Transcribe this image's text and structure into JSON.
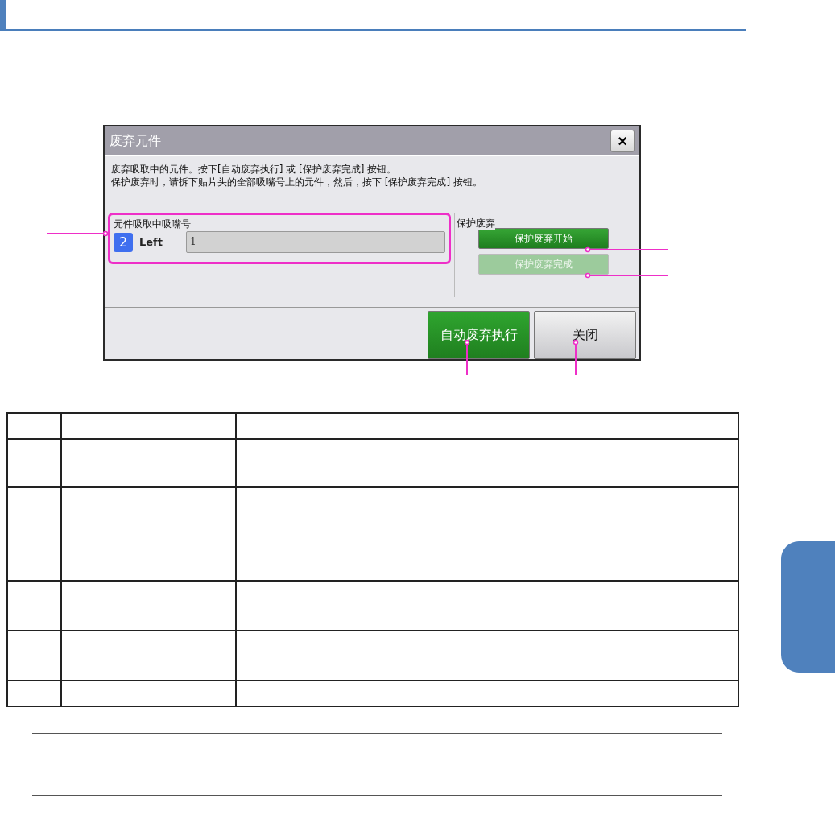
{
  "dialog": {
    "title": "废弃元件",
    "close_label": "×",
    "message": [
      "废弃吸取中的元件。按下[自动废弃执行] 或 [保护废弃完成] 按钮。",
      "保护废弃时，请拆下贴片头的全部吸嘴号上的元件，然后，按下 [保护废弃完成] 按钮。"
    ],
    "nozzle_group": {
      "label": "元件吸取中吸嘴号",
      "number": "2",
      "side": "Left",
      "value": "1"
    },
    "protect_group": {
      "label": "保护废弃",
      "buttons": [
        {
          "label": "保护废弃开始",
          "disabled": false
        },
        {
          "label": "保护废弃完成",
          "disabled": true
        }
      ]
    },
    "footer_buttons": [
      {
        "label": "自动废弃执行",
        "kind": "primary"
      },
      {
        "label": "关闭",
        "kind": "default"
      }
    ]
  }
}
